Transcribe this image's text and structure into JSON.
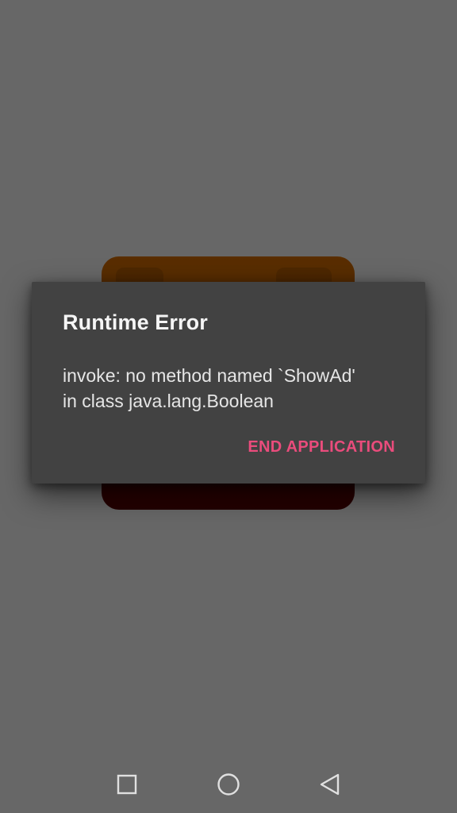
{
  "dialog": {
    "title": "Runtime Error",
    "message_line1": "invoke: no method named `ShowAd'",
    "message_line2": "in class java.lang.Boolean",
    "action_label": "END APPLICATION"
  },
  "colors": {
    "scrim": "#676767",
    "dialog_background": "#424242",
    "accent": "#ea4c7c",
    "nav_icon": "#e0e0e0"
  },
  "navbar": {
    "icons": [
      "recents-icon",
      "home-icon",
      "back-icon"
    ]
  }
}
